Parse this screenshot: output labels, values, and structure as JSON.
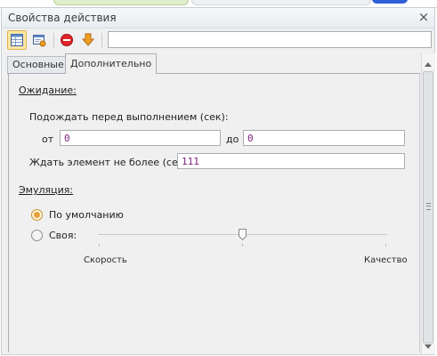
{
  "window": {
    "title": "Свойства действия",
    "close_symbol": "×"
  },
  "toolbar": {
    "icons": [
      "table-view-icon",
      "properties-window-icon",
      "stop-icon",
      "down-arrow-icon"
    ],
    "search_value": ""
  },
  "tabs": [
    {
      "label": "Основные",
      "active": false
    },
    {
      "label": "Дополнительно",
      "active": true
    }
  ],
  "waiting": {
    "heading": "Ожидание:",
    "wait_before_label": "Подождать перед выполнением (сек):",
    "from_label": "от",
    "from_value": "0",
    "to_label": "до",
    "to_value": "0",
    "max_wait_label": "Ждать элемент не более (сек):",
    "max_wait_value": "111"
  },
  "emulation": {
    "heading": "Эмуляция:",
    "options": [
      {
        "label": "По умолчанию",
        "selected": true
      },
      {
        "label": "Своя:",
        "selected": false
      }
    ],
    "slider": {
      "left_label": "Скорость",
      "right_label": "Качество",
      "position": 0.5
    }
  },
  "colors": {
    "value_text": "#7a1f7a",
    "radio_selected": "#e9a23b",
    "stop_icon": "#e0262a",
    "arrow_icon": "#f0a020"
  }
}
